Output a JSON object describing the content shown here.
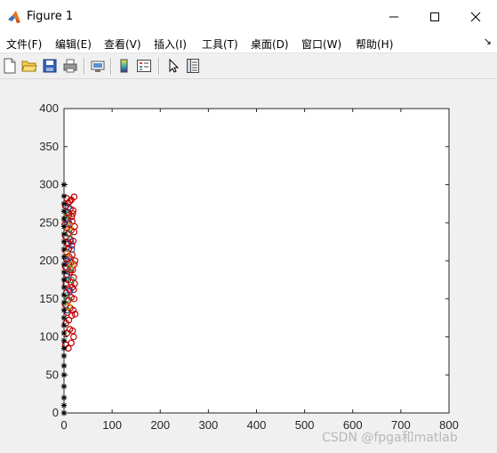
{
  "window": {
    "title": "Figure 1",
    "icon": "matlab-logo-icon",
    "controls": [
      "minimize-icon",
      "maximize-icon",
      "close-icon"
    ]
  },
  "menubar": {
    "items": [
      {
        "label": "文件(F)"
      },
      {
        "label": "编辑(E)"
      },
      {
        "label": "查看(V)"
      },
      {
        "label": "插入(I)"
      },
      {
        "label": "工具(T)"
      },
      {
        "label": "桌面(D)"
      },
      {
        "label": "窗口(W)"
      },
      {
        "label": "帮助(H)"
      }
    ],
    "overflow": "↘"
  },
  "toolbar": {
    "buttons": [
      "new-figure-icon",
      "open-file-icon",
      "save-icon",
      "print-icon",
      "link-plot-icon",
      "insert-colorbar-icon",
      "insert-legend-icon",
      "edit-plot-arrow-icon",
      "property-inspector-icon"
    ]
  },
  "watermark": "CSDN @fpga和matlab",
  "colors": {
    "background": "#f0f0f0",
    "axes": "#ffffff",
    "circle_red": "#c00000",
    "star_black": "#000000"
  },
  "chart_data": {
    "type": "scatter",
    "xlim": [
      0,
      800
    ],
    "ylim": [
      0,
      400
    ],
    "xticks": [
      0,
      100,
      200,
      300,
      400,
      500,
      600,
      700,
      800
    ],
    "yticks": [
      0,
      50,
      100,
      150,
      200,
      250,
      300,
      350,
      400
    ],
    "grid": false,
    "series": [
      {
        "marker": "star",
        "color": "#000000",
        "points": [
          [
            0,
            0
          ],
          [
            0,
            10
          ],
          [
            0,
            20
          ],
          [
            0,
            35
          ],
          [
            0,
            50
          ],
          [
            0,
            62
          ],
          [
            0,
            75
          ],
          [
            0,
            85
          ],
          [
            0,
            95
          ],
          [
            0,
            105
          ],
          [
            0,
            115
          ],
          [
            0,
            125
          ],
          [
            0,
            135
          ],
          [
            0,
            145
          ],
          [
            0,
            155
          ],
          [
            0,
            165
          ],
          [
            0,
            175
          ],
          [
            0,
            185
          ],
          [
            0,
            195
          ],
          [
            0,
            205
          ],
          [
            0,
            215
          ],
          [
            0,
            225
          ],
          [
            0,
            235
          ],
          [
            0,
            245
          ],
          [
            0,
            255
          ],
          [
            0,
            265
          ],
          [
            0,
            275
          ],
          [
            0,
            285
          ],
          [
            0,
            300
          ]
        ]
      },
      {
        "marker": "circle",
        "color": "#c00000",
        "points": [
          [
            3,
            90
          ],
          [
            9,
            85
          ],
          [
            15,
            92
          ],
          [
            20,
            100
          ],
          [
            6,
            105
          ],
          [
            12,
            110
          ],
          [
            18,
            108
          ],
          [
            4,
            118
          ],
          [
            10,
            122
          ],
          [
            16,
            128
          ],
          [
            7,
            132
          ],
          [
            13,
            138
          ],
          [
            19,
            135
          ],
          [
            3,
            142
          ],
          [
            9,
            148
          ],
          [
            15,
            152
          ],
          [
            21,
            150
          ],
          [
            5,
            158
          ],
          [
            11,
            162
          ],
          [
            17,
            165
          ],
          [
            4,
            170
          ],
          [
            8,
            175
          ],
          [
            14,
            172
          ],
          [
            20,
            178
          ],
          [
            6,
            182
          ],
          [
            12,
            185
          ],
          [
            18,
            188
          ],
          [
            3,
            192
          ],
          [
            9,
            196
          ],
          [
            15,
            198
          ],
          [
            21,
            195
          ],
          [
            5,
            202
          ],
          [
            11,
            205
          ],
          [
            17,
            208
          ],
          [
            4,
            212
          ],
          [
            10,
            216
          ],
          [
            16,
            220
          ],
          [
            7,
            224
          ],
          [
            13,
            228
          ],
          [
            19,
            226
          ],
          [
            3,
            232
          ],
          [
            9,
            236
          ],
          [
            15,
            240
          ],
          [
            21,
            238
          ],
          [
            5,
            244
          ],
          [
            11,
            248
          ],
          [
            17,
            252
          ],
          [
            4,
            256
          ],
          [
            10,
            260
          ],
          [
            16,
            258
          ],
          [
            7,
            264
          ],
          [
            13,
            268
          ],
          [
            19,
            266
          ],
          [
            3,
            272
          ],
          [
            9,
            276
          ],
          [
            15,
            280
          ],
          [
            21,
            284
          ],
          [
            6,
            282
          ],
          [
            12,
            278
          ],
          [
            18,
            262
          ],
          [
            2,
            248
          ],
          [
            8,
            222
          ],
          [
            14,
            188
          ],
          [
            20,
            162
          ],
          [
            22,
            245
          ],
          [
            23,
            200
          ],
          [
            22,
            170
          ],
          [
            23,
            130
          ]
        ]
      },
      {
        "marker": "circle",
        "color": "#1f4e9c",
        "points": [
          [
            6,
            135
          ],
          [
            12,
            160
          ],
          [
            8,
            200
          ],
          [
            14,
            225
          ],
          [
            10,
            250
          ],
          [
            5,
            180
          ],
          [
            16,
            215
          ],
          [
            9,
            270
          ]
        ]
      },
      {
        "marker": "circle",
        "color": "#2e8b57",
        "points": [
          [
            7,
            150
          ],
          [
            13,
            190
          ],
          [
            11,
            235
          ],
          [
            15,
            175
          ],
          [
            6,
            260
          ]
        ]
      },
      {
        "marker": "circle",
        "color": "#d4a017",
        "points": [
          [
            9,
            140
          ],
          [
            5,
            210
          ],
          [
            12,
            245
          ],
          [
            17,
            195
          ]
        ]
      }
    ]
  }
}
